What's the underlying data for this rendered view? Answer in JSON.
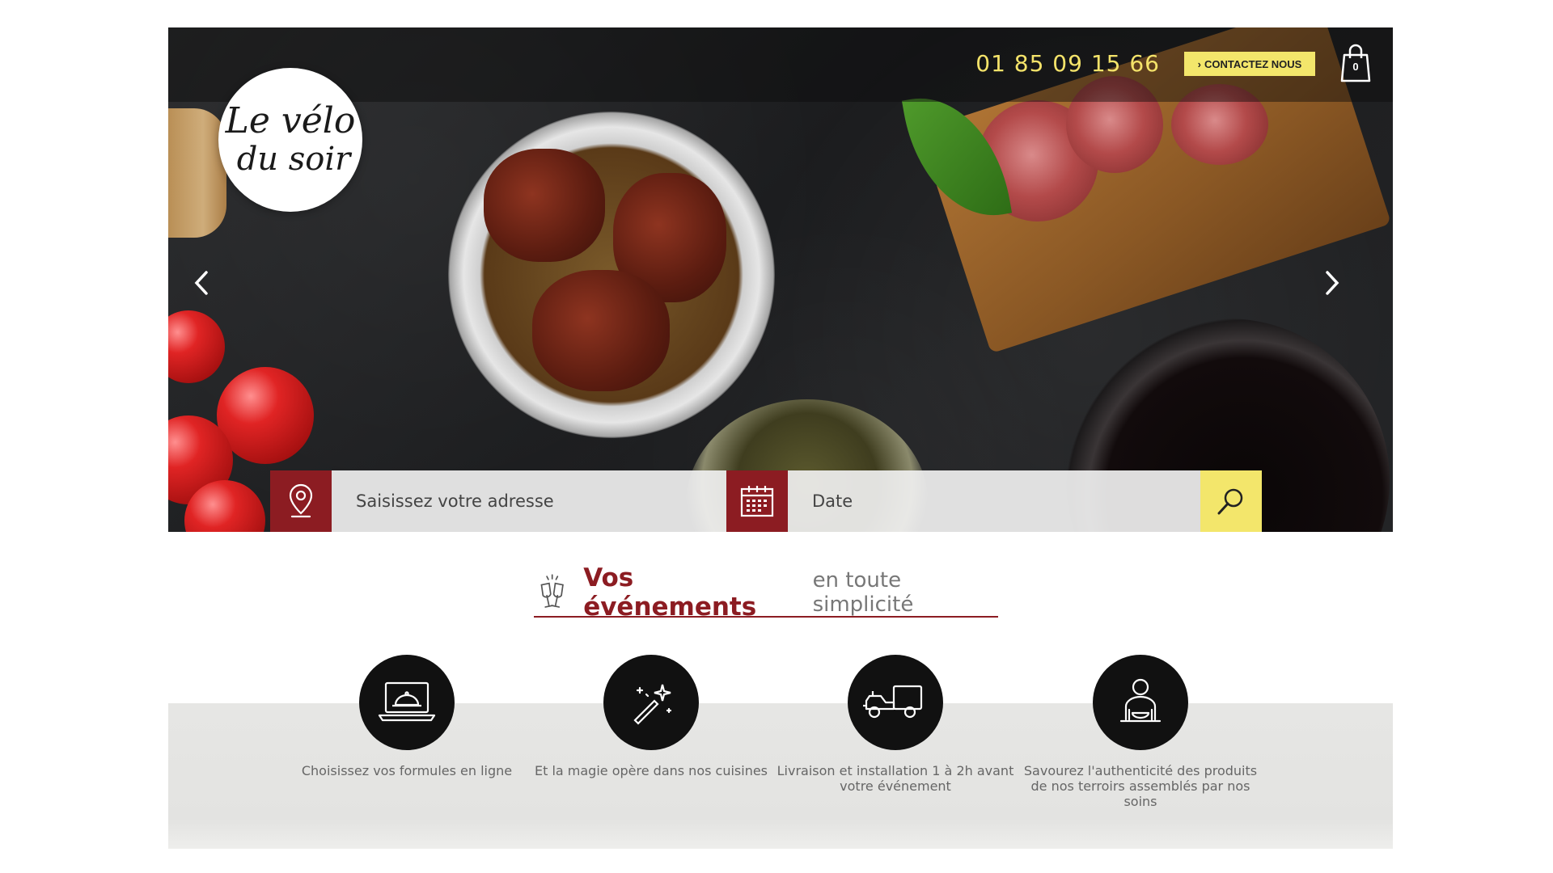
{
  "brand": {
    "logo_line1": "Le vélo",
    "logo_line2": "du soir",
    "accent_color": "#8c1c22",
    "highlight_color": "#f3e66b"
  },
  "header": {
    "phone": "01 85 09 15 66",
    "contact_label": "CONTACTEZ NOUS",
    "cart_count": "0",
    "cart_icon": "shopping-bag-icon"
  },
  "carousel": {
    "prev_icon": "chevron-left-icon",
    "next_icon": "chevron-right-icon"
  },
  "search": {
    "address_placeholder": "Saisissez votre adresse",
    "date_placeholder": "Date",
    "location_icon": "map-pin-icon",
    "calendar_icon": "calendar-icon",
    "submit_icon": "search-icon"
  },
  "section": {
    "title_strong": "Vos événements",
    "title_light": "en toute simplicité",
    "icon": "champagne-glasses-icon"
  },
  "features": [
    {
      "icon": "laptop-cloche-icon",
      "caption": "Choisissez vos formules en ligne"
    },
    {
      "icon": "magic-wand-icon",
      "caption": "Et la magie opère dans nos cuisines"
    },
    {
      "icon": "delivery-truck-icon",
      "caption": "Livraison et installation 1 à 2h avant votre événement"
    },
    {
      "icon": "person-dining-icon",
      "caption": "Savourez l'authenticité des produits de nos terroirs assemblés par nos soins"
    }
  ]
}
